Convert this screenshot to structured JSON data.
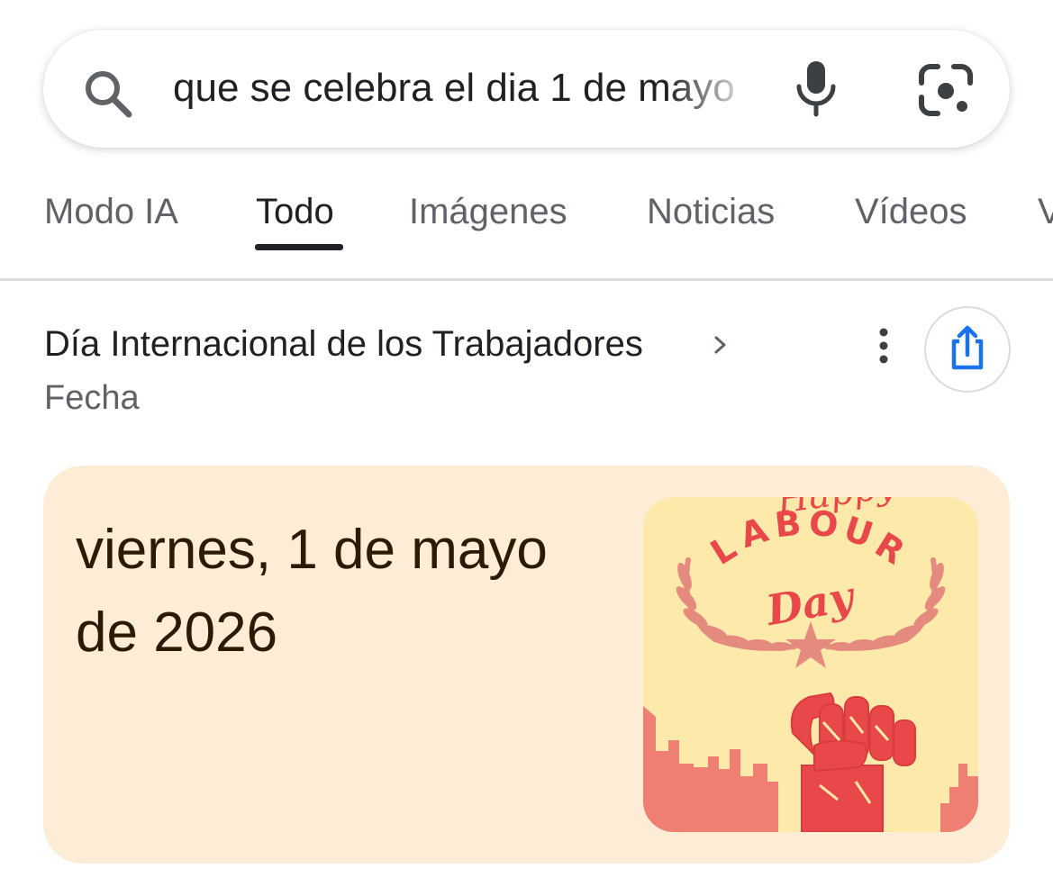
{
  "search": {
    "query": "que se celebra el dia 1 de mayo"
  },
  "tabs": [
    {
      "label": "Modo IA",
      "active": false
    },
    {
      "label": "Todo",
      "active": true
    },
    {
      "label": "Imágenes",
      "active": false
    },
    {
      "label": "Noticias",
      "active": false
    },
    {
      "label": "Vídeos",
      "active": false
    }
  ],
  "result": {
    "title": "Día Internacional de los Trabajadores",
    "subtitle": "Fecha",
    "answer_date": "viernes, 1 de mayo de 2026",
    "image": {
      "text_happy": "Happy",
      "text_labour": "LABOUR",
      "text_day": "Day"
    }
  },
  "colors": {
    "card_background": "#feedd6",
    "share_accent": "#1a73e8",
    "active_tab": "#202124",
    "inactive_tab": "#5f6368",
    "image_red": "#e8484a"
  },
  "icons": {
    "search": "search-icon",
    "mic": "mic-icon",
    "lens": "camera-lens-icon",
    "chevron": "chevron-right-icon",
    "more": "more-vertical-icon",
    "share": "share-icon",
    "fist": "raised-fist-icon",
    "star": "star-icon"
  }
}
